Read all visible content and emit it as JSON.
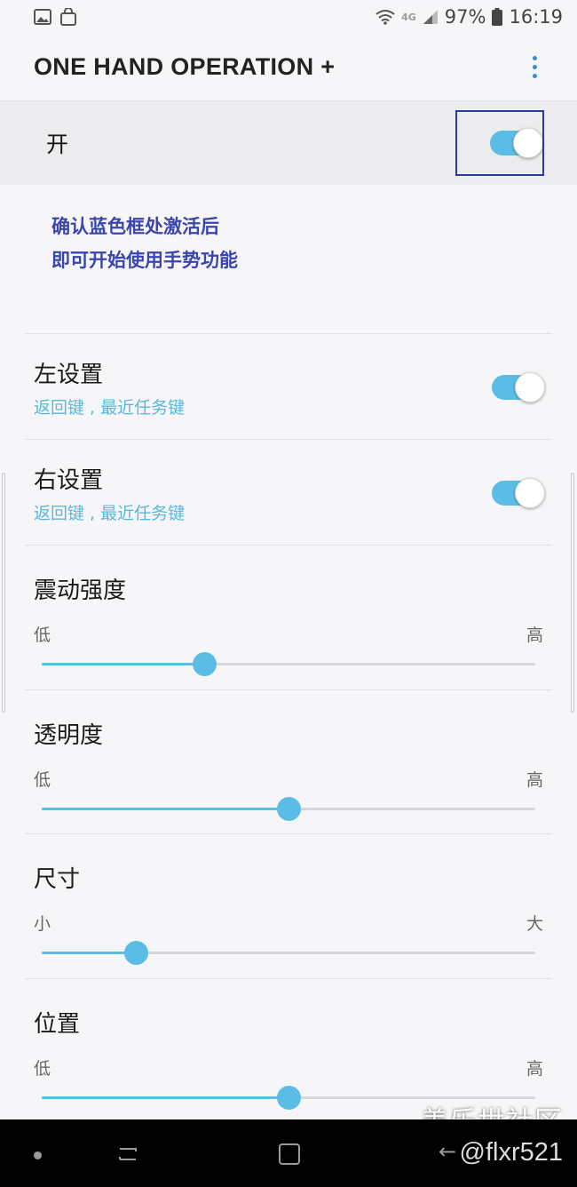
{
  "status_bar": {
    "network_label": "4G",
    "battery": "97%",
    "time": "16:19"
  },
  "app_bar": {
    "title": "ONE HAND OPERATION +"
  },
  "master_switch": {
    "label": "开",
    "on": true
  },
  "hint": {
    "line1": "确认蓝色框处激活后",
    "line2": "即可开始使用手势功能"
  },
  "settings": [
    {
      "title": "左设置",
      "subtitle": "返回键 , 最近任务键",
      "on": true
    },
    {
      "title": "右设置",
      "subtitle": "返回键 , 最近任务键",
      "on": true
    }
  ],
  "sliders": [
    {
      "title": "震动强度",
      "min_label": "低",
      "max_label": "高",
      "value": 0.33
    },
    {
      "title": "透明度",
      "min_label": "低",
      "max_label": "高",
      "value": 0.5
    },
    {
      "title": "尺寸",
      "min_label": "小",
      "max_label": "大",
      "value": 0.19
    },
    {
      "title": "位置",
      "min_label": "低",
      "max_label": "高",
      "value": 0.5
    }
  ],
  "watermark": {
    "top": "盖乐世社区",
    "bottom": "@flxr521"
  },
  "colors": {
    "accent": "#5bbde6",
    "hint": "#3a45b0",
    "highlight_box": "#2a3a9e"
  }
}
